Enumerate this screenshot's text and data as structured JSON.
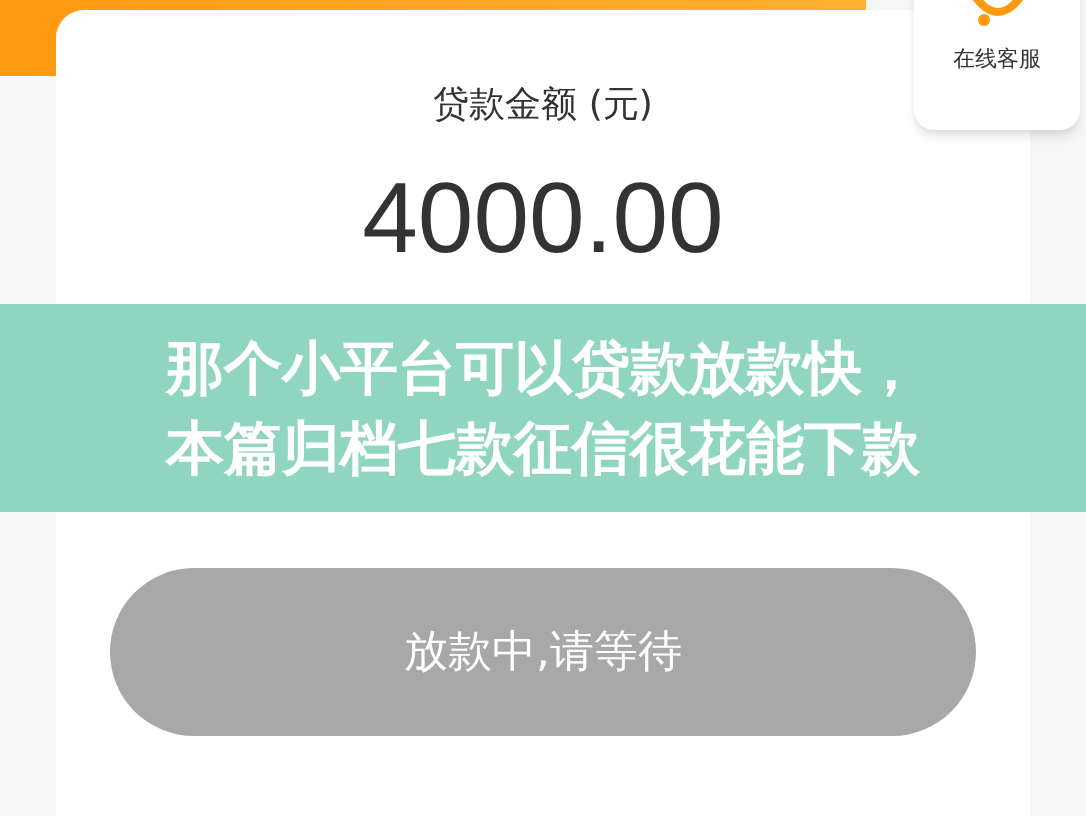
{
  "support": {
    "label": "在线客服"
  },
  "amount": {
    "label": "贷款金额 (元)",
    "value": "4000.00"
  },
  "banner": {
    "lines": [
      "那个小平台可以贷款放款快，",
      "本篇归档七款征信很花能下款"
    ]
  },
  "button": {
    "label": "放款中,请等待",
    "disabled": true
  }
}
